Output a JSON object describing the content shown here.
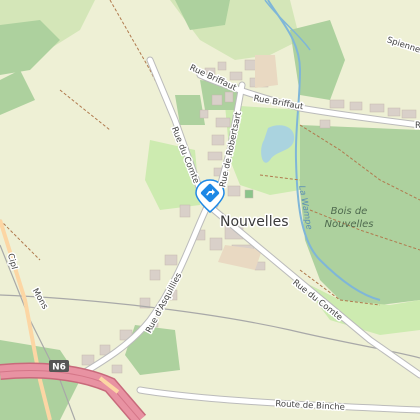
{
  "map": {
    "place_name": "Nouvelles",
    "wood_name_line1": "Bois de",
    "wood_name_line2": "Nouvelles",
    "river_name": "La Wampe",
    "locality_label": "Spiennes",
    "road_labels": {
      "rue_briffaut_1": "Rue Briffaut",
      "rue_briffaut_2": "Rue Briffaut",
      "rue_de_robertsart": "Rue de Robertsart",
      "rue_du_comte_north": "Rue du Comte",
      "rue_du_comte_south": "Rue du Comte",
      "rue_d_asquillies": "Rue d'Asquillies",
      "route_de_binche": "Route de Binche",
      "mons_rail": "Mons"
    },
    "edge_labels": {
      "left_edge": "Cipl",
      "right_edge": "R"
    },
    "motorway_shield": "N6",
    "marker_icon": "location-pin-icon",
    "colors": {
      "background": "#f2efe9",
      "farmland": "#eef0d5",
      "forest": "#add19e",
      "meadow": "#cdebb0",
      "water": "#aad3df",
      "river": "#7fb6d8",
      "building": "#d9d0c9",
      "road_casing": "#bbbbbb",
      "motorway": "#e892a2",
      "primary_road": "#fcd6a4",
      "marker": "#1e88e5"
    }
  }
}
